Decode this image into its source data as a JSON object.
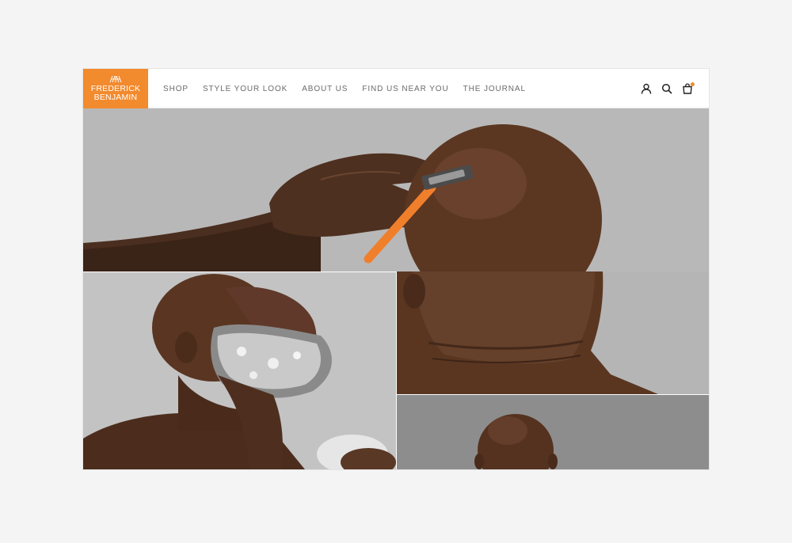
{
  "brand": {
    "line1": "FREDERICK",
    "line2": "BENJAMIN",
    "color": "#f28a2e"
  },
  "nav": {
    "items": [
      {
        "label": "SHOP"
      },
      {
        "label": "STYLE YOUR LOOK"
      },
      {
        "label": "ABOUT US"
      },
      {
        "label": "FIND US NEAR YOU"
      },
      {
        "label": "THE JOURNAL"
      }
    ]
  },
  "header_icons": [
    "account-icon",
    "search-icon",
    "cart-icon"
  ],
  "hero": {
    "images": [
      {
        "name": "shaving-head-photo"
      },
      {
        "name": "lathered-beard-photo"
      },
      {
        "name": "bald-head-portrait-photo"
      }
    ]
  }
}
